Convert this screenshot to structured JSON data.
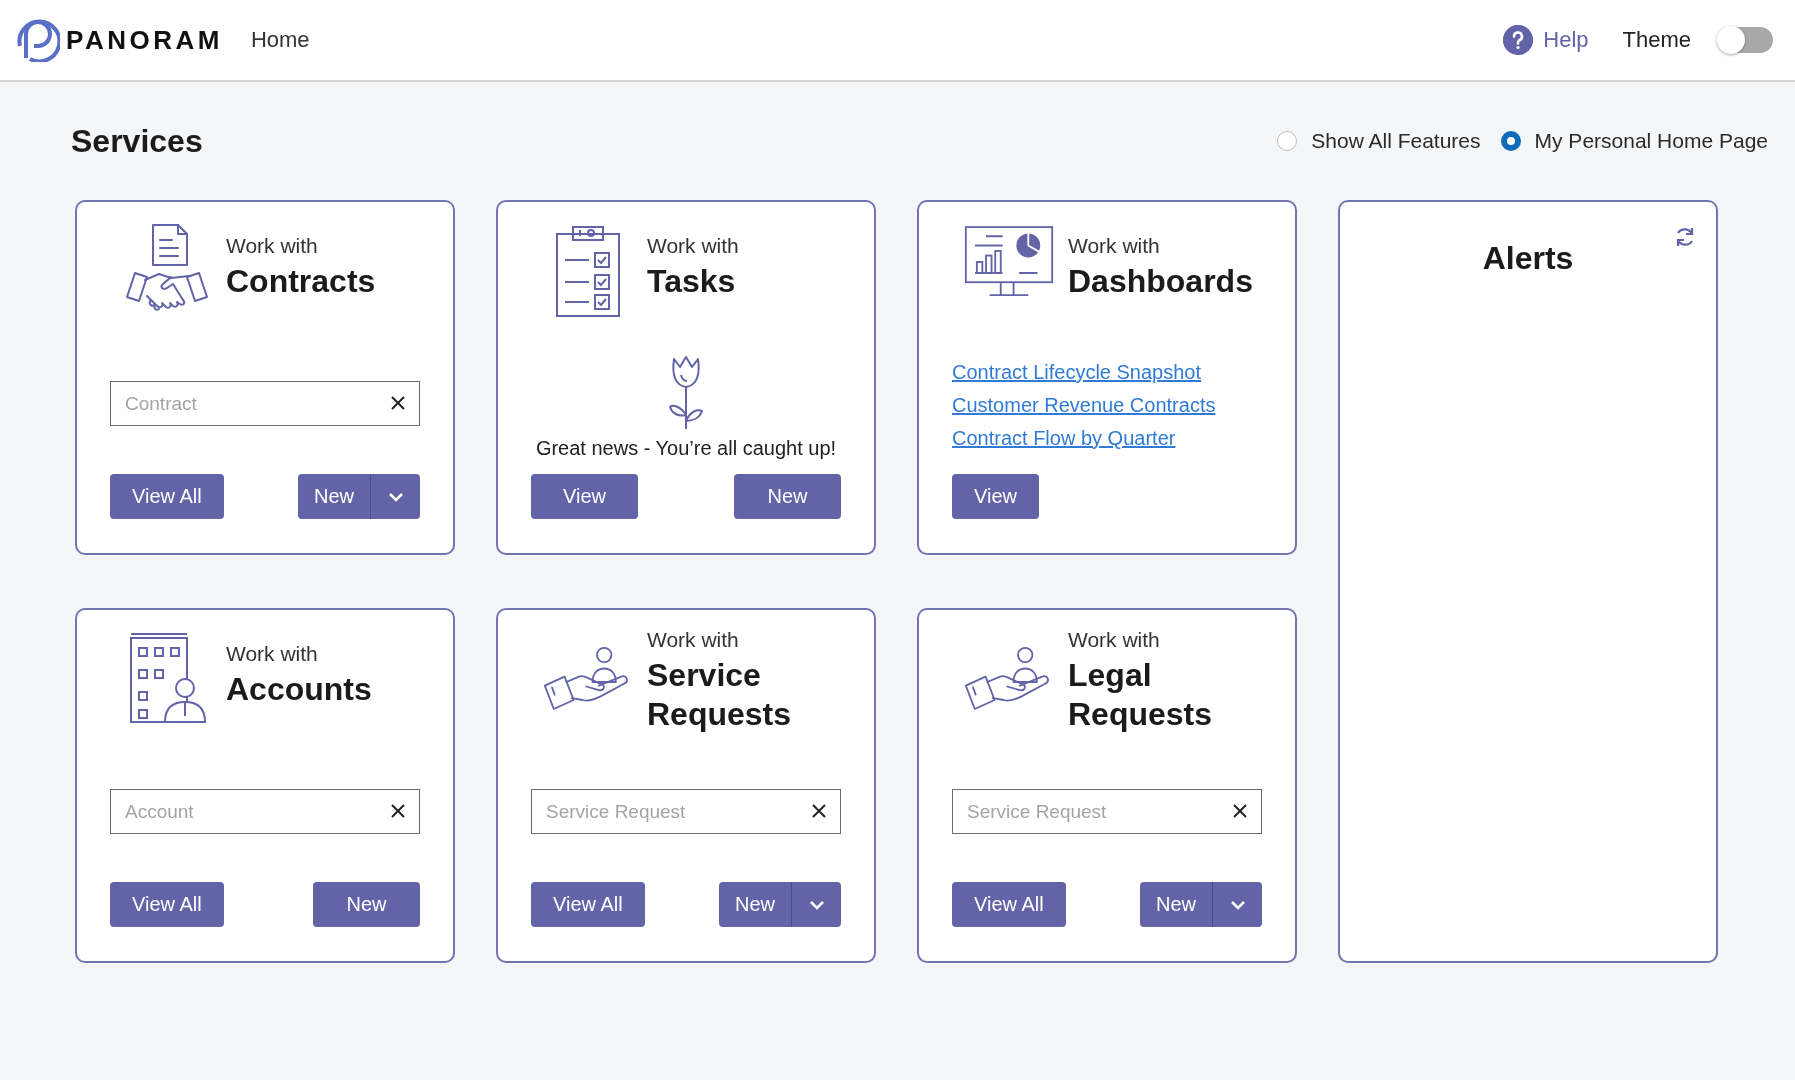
{
  "header": {
    "brand": "PANORAM",
    "nav": "Home",
    "help": "Help",
    "theme": {
      "label": "Theme",
      "on": false
    }
  },
  "page": {
    "title": "Services",
    "view_options": [
      {
        "label": "Show All Features",
        "selected": false
      },
      {
        "label": "My Personal Home Page",
        "selected": true
      }
    ]
  },
  "cards": [
    {
      "kind": "search",
      "intro": "Work with",
      "title": "Contracts",
      "placeholder": "Contract",
      "buttons": [
        {
          "label": "View All",
          "has_menu": false
        },
        {
          "label": "New",
          "has_menu": true
        }
      ]
    },
    {
      "kind": "message",
      "intro": "Work with",
      "title": "Tasks",
      "message": "Great news - You’re all caught up!",
      "buttons": [
        {
          "label": "View",
          "has_menu": false
        },
        {
          "label": "New",
          "has_menu": false
        }
      ]
    },
    {
      "kind": "links",
      "intro": "Work with",
      "title": "Dashboards",
      "links": [
        "Contract Lifecycle Snapshot",
        "Customer Revenue Contracts",
        "Contract Flow by Quarter"
      ],
      "buttons": [
        {
          "label": "View",
          "has_menu": false
        }
      ]
    },
    {
      "kind": "search",
      "intro": "Work with",
      "title": "Accounts",
      "placeholder": "Account",
      "buttons": [
        {
          "label": "View All",
          "has_menu": false
        },
        {
          "label": "New",
          "has_menu": false
        }
      ]
    },
    {
      "kind": "search",
      "intro": "Work with",
      "title": "Service Requests",
      "placeholder": "Service Request",
      "buttons": [
        {
          "label": "View All",
          "has_menu": false
        },
        {
          "label": "New",
          "has_menu": true
        }
      ]
    },
    {
      "kind": "search",
      "intro": "Work with",
      "title": "Legal Requests",
      "placeholder": "Service Request",
      "buttons": [
        {
          "label": "View All",
          "has_menu": false
        },
        {
          "label": "New",
          "has_menu": true
        }
      ]
    }
  ],
  "alerts": {
    "title": "Alerts"
  }
}
